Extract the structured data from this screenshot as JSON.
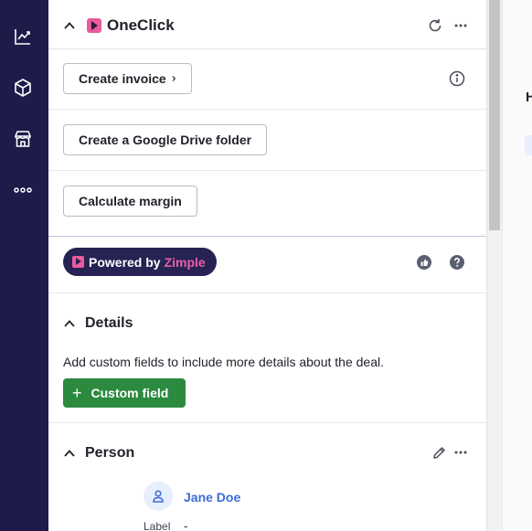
{
  "rail": {
    "items": [
      {
        "icon": "insights-icon"
      },
      {
        "icon": "products-icon"
      },
      {
        "icon": "marketplace-icon"
      },
      {
        "icon": "more-icon"
      }
    ]
  },
  "oneclick": {
    "title": "OneClick",
    "buttons": {
      "create_invoice": "Create invoice",
      "create_folder": "Create a Google Drive folder",
      "calculate_margin": "Calculate margin"
    },
    "powered_by": "Powered by",
    "powered_brand": "Zimple"
  },
  "details": {
    "title": "Details",
    "description": "Add custom fields to include more details about the deal.",
    "add_button": "Custom field"
  },
  "person": {
    "title": "Person",
    "name": "Jane Doe",
    "label_key": "Label",
    "label_value": "-"
  },
  "right_pane": {
    "letter": "H"
  },
  "colors": {
    "rail_bg": "#1e1b4b",
    "brand_pink": "#e85b9c",
    "powered_bg": "#262254",
    "green": "#2c8a3f",
    "link_blue": "#3b6bd6"
  }
}
